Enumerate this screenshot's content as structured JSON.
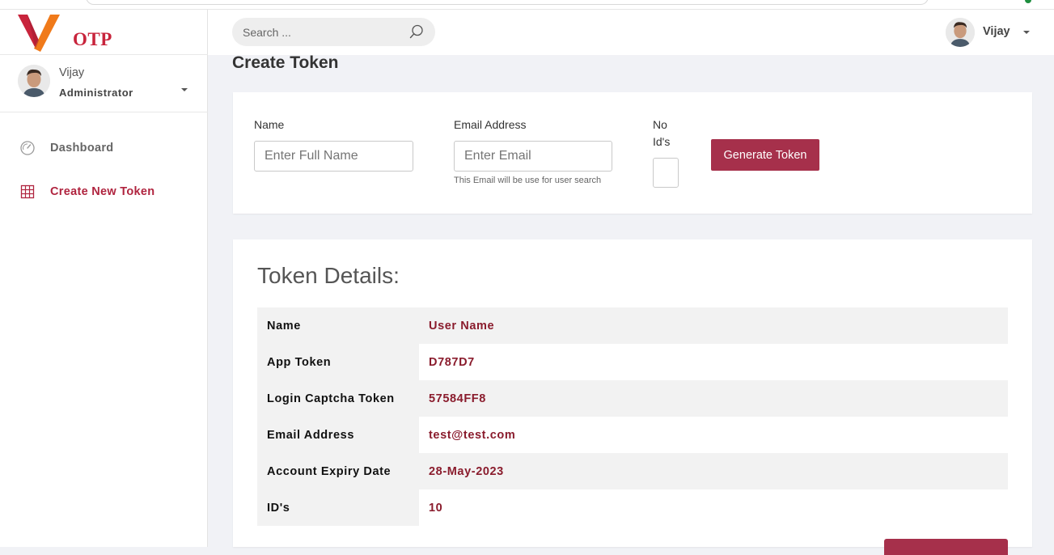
{
  "app": {
    "logo_text": "OTP"
  },
  "sidebar": {
    "user": {
      "name": "Vijay",
      "role": "Administrator"
    },
    "items": [
      {
        "label": "Dashboard",
        "icon": "dashboard-gauge-icon",
        "active": false
      },
      {
        "label": "Create New Token",
        "icon": "grid-table-icon",
        "active": true
      }
    ]
  },
  "header": {
    "search_placeholder": "Search ...",
    "user_name": "Vijay"
  },
  "page": {
    "title": "Create Token"
  },
  "form": {
    "name_label": "Name",
    "name_placeholder": "Enter Full Name",
    "email_label": "Email Address",
    "email_placeholder": "Enter Email",
    "email_help": "This Email will be use for user search",
    "ids_label_line1": "No",
    "ids_label_line2": "Id's",
    "ids_value": "",
    "generate_label": "Generate Token"
  },
  "details": {
    "title": "Token Details:",
    "rows": [
      {
        "key": "Name",
        "value": "User Name"
      },
      {
        "key": "App Token",
        "value": "D787D7"
      },
      {
        "key": "Login Captcha Token",
        "value": "57584FF8"
      },
      {
        "key": "Email Address",
        "value": "test@test.com"
      },
      {
        "key": "Account Expiry Date",
        "value": "28-May-2023"
      },
      {
        "key": "ID's",
        "value": "10"
      }
    ]
  },
  "colors": {
    "accent": "#a6304b",
    "value_text": "#8a1c2d",
    "active_nav": "#b0243f",
    "logo_red": "#c8243c",
    "logo_orange": "#f07a1a"
  }
}
